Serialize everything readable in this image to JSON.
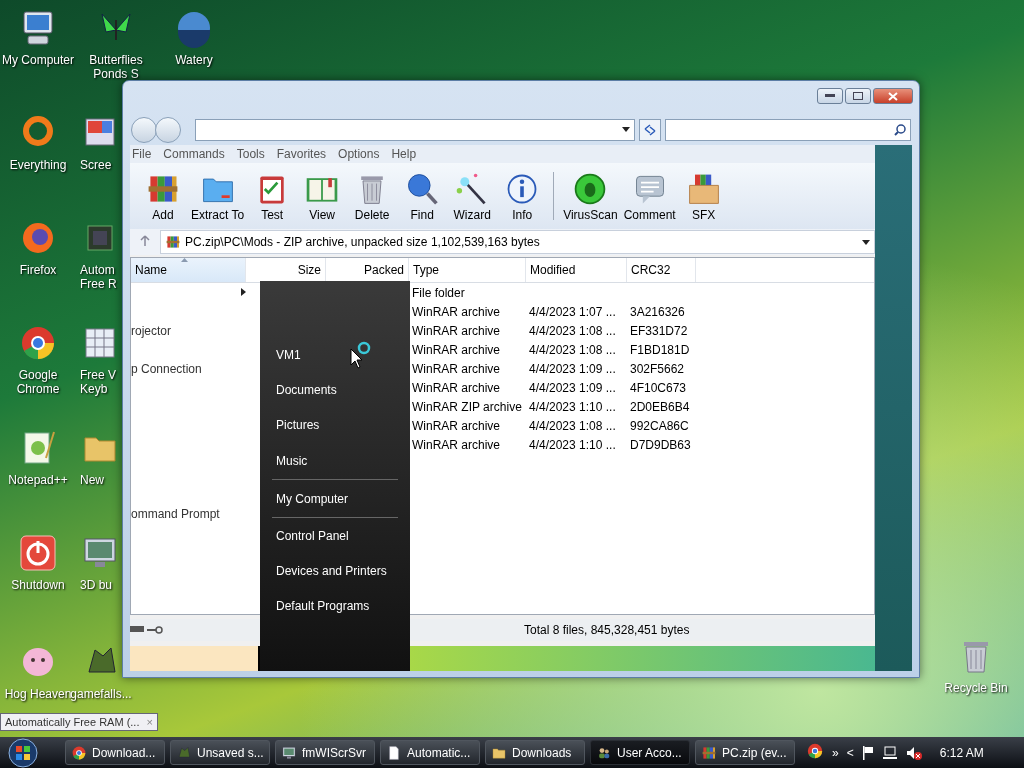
{
  "desktop_icons": [
    [
      {
        "label": "My Computer",
        "kind": "computer"
      },
      {
        "label": "Everything",
        "kind": "ring"
      },
      {
        "label": "Firefox",
        "kind": "firefox"
      },
      {
        "label": "Google Chrome",
        "kind": "chrome"
      },
      {
        "label": "Notepad++",
        "kind": "notepad"
      },
      {
        "label": "Shutdown",
        "kind": "power"
      },
      {
        "label": "Hog Heaven",
        "kind": "pig"
      }
    ],
    [
      {
        "label": "Butterflies\nPonds S",
        "kind": "butterfly"
      },
      {
        "label": "Scree",
        "kind": "screen"
      },
      {
        "label": "Autom\nFree R",
        "kind": "chip"
      },
      {
        "label": "Free V\nKeyb",
        "kind": "keyboard"
      },
      {
        "label": "New",
        "kind": "folder"
      },
      {
        "label": "3D bu",
        "kind": "monitor"
      },
      {
        "label": "gamefalls...",
        "kind": "game"
      }
    ],
    [
      {
        "label": "Watery",
        "kind": "globe"
      }
    ]
  ],
  "recycle_bin": {
    "label": "Recycle Bin"
  },
  "window": {
    "menu": [
      "File",
      "Commands",
      "Tools",
      "Favorites",
      "Options",
      "Help"
    ],
    "toolbar": [
      {
        "label": "Add",
        "kind": "add"
      },
      {
        "label": "Extract To",
        "kind": "extract"
      },
      {
        "label": "Test",
        "kind": "test"
      },
      {
        "label": "View",
        "kind": "view"
      },
      {
        "label": "Delete",
        "kind": "delete"
      },
      {
        "label": "Find",
        "kind": "find"
      },
      {
        "label": "Wizard",
        "kind": "wizard"
      },
      {
        "label": "Info",
        "kind": "info"
      },
      {
        "label": "VirusScan",
        "kind": "virus"
      },
      {
        "label": "Comment",
        "kind": "comment"
      },
      {
        "label": "SFX",
        "kind": "sfx"
      }
    ],
    "path": "PC.zip\\PC\\Mods - ZIP archive, unpacked size 1,102,539,163 bytes",
    "columns": [
      {
        "label": "Name",
        "sorted": true
      },
      {
        "label": "Size",
        "sorted": false
      },
      {
        "label": "Packed",
        "sorted": false
      },
      {
        "label": "Type",
        "sorted": false
      },
      {
        "label": "Modified",
        "sorted": false
      },
      {
        "label": "CRC32",
        "sorted": false
      }
    ],
    "rows": [
      {
        "type": "File folder"
      },
      {
        "type": "WinRAR archive",
        "modified": "4/4/2023 1:07 ...",
        "crc32": "3A216326"
      },
      {
        "type": "WinRAR archive",
        "modified": "4/4/2023 1:08 ...",
        "crc32": "EF331D72"
      },
      {
        "type": "WinRAR archive",
        "modified": "4/4/2023 1:08 ...",
        "crc32": "F1BD181D"
      },
      {
        "type": "WinRAR archive",
        "modified": "4/4/2023 1:09 ...",
        "crc32": "302F5662"
      },
      {
        "type": "WinRAR archive",
        "modified": "4/4/2023 1:09 ...",
        "crc32": "4F10C673"
      },
      {
        "type": "WinRAR ZIP archive",
        "modified": "4/4/2023 1:10 ...",
        "crc32": "2D0EB6B4"
      },
      {
        "type": "WinRAR archive",
        "modified": "4/4/2023 1:08 ...",
        "crc32": "992CA86C"
      },
      {
        "type": "WinRAR archive",
        "modified": "4/4/2023 1:10 ...",
        "crc32": "D7D9DB63"
      }
    ],
    "ghost_texts": [
      "rojector",
      "p Connection",
      "ommand Prompt"
    ],
    "status": "Total 8 files, 845,328,451 bytes"
  },
  "start_menu": [
    {
      "label": "VM1",
      "separator_after": false
    },
    {
      "label": "Documents",
      "separator_after": false
    },
    {
      "label": "Pictures",
      "separator_after": false
    },
    {
      "label": "Music",
      "separator_after": true
    },
    {
      "label": "My Computer",
      "separator_after": true
    },
    {
      "label": "Control Panel",
      "separator_after": false
    },
    {
      "label": "Devices and Printers",
      "separator_after": false
    },
    {
      "label": "Default Programs",
      "separator_after": false
    }
  ],
  "tooltip": {
    "text": "Automatically Free RAM (...",
    "close": "×"
  },
  "taskbar": {
    "tasks": [
      {
        "label": "Download...",
        "kind": "chrome",
        "selected": false
      },
      {
        "label": "Unsaved s...",
        "kind": "game",
        "selected": false
      },
      {
        "label": "fmWIScrSvr",
        "kind": "monitor",
        "selected": false
      },
      {
        "label": "Automatic...",
        "kind": "document",
        "selected": false
      },
      {
        "label": "Downloads",
        "kind": "folder",
        "selected": false
      },
      {
        "label": "User Acco...",
        "kind": "users",
        "selected": true
      },
      {
        "label": "PC.zip (ev...",
        "kind": "add",
        "selected": false
      }
    ],
    "overflow": "»",
    "back": "<",
    "clock": "6:12 AM"
  }
}
